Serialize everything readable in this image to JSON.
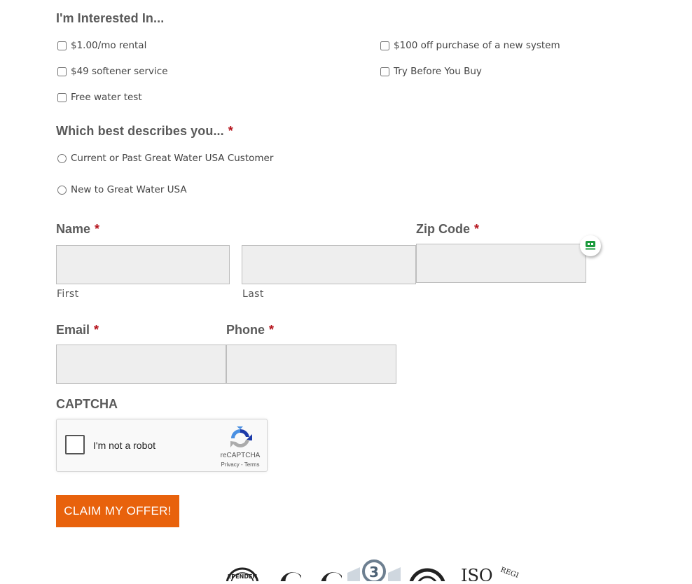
{
  "interests": {
    "title": "I'm Interested In...",
    "options": [
      {
        "label": "$1.00/mo rental",
        "checked": false
      },
      {
        "label": "$100 off purchase of a new system",
        "checked": false
      },
      {
        "label": "$49 softener service",
        "checked": false
      },
      {
        "label": "Try Before You Buy",
        "checked": false
      },
      {
        "label": "Free water test",
        "checked": false
      }
    ]
  },
  "describes": {
    "title": "Which best describes you...",
    "required_mark": "*",
    "options": [
      {
        "label": "Current or Past Great Water USA Customer",
        "selected": false
      },
      {
        "label": "New to Great Water USA",
        "selected": false
      }
    ]
  },
  "name": {
    "label": "Name",
    "required_mark": "*",
    "first_label": "First",
    "last_label": "Last",
    "first_value": "",
    "last_value": ""
  },
  "zip": {
    "label": "Zip Code",
    "required_mark": "*",
    "value": ""
  },
  "email": {
    "label": "Email",
    "required_mark": "*",
    "value": ""
  },
  "phone": {
    "label": "Phone",
    "required_mark": "*",
    "value": ""
  },
  "captcha": {
    "title": "CAPTCHA",
    "checkbox_label": "I'm not a robot",
    "brand": "reCAPTCHA",
    "privacy": "Privacy",
    "separator": " - ",
    "terms": "Terms"
  },
  "submit_label": "CLAIM MY OFFER!",
  "footer_logos": {
    "badge_number": "3",
    "iso_text": "ISO",
    "regi_text": "REGI",
    "independent_text": "EPENDEN"
  },
  "colors": {
    "accent": "#e8620c",
    "required": "#b5121b",
    "label": "#5a5a5a",
    "field_bg": "#eeeeee"
  }
}
